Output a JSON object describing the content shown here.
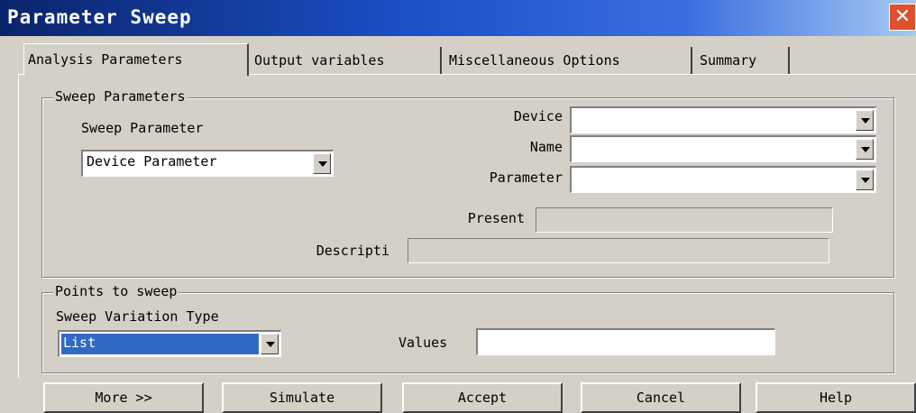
{
  "window": {
    "title": "Parameter Sweep",
    "close_glyph": "✕"
  },
  "tabs": [
    {
      "label": "Analysis Parameters"
    },
    {
      "label": "Output variables"
    },
    {
      "label": "Miscellaneous Options"
    },
    {
      "label": "Summary"
    }
  ],
  "sweep_parameters": {
    "group_title": "Sweep Parameters",
    "sweep_parameter_label": "Sweep Parameter",
    "sweep_parameter_value": "Device Parameter",
    "device_label": "Device",
    "device_value": "",
    "name_label": "Name",
    "name_value": "",
    "parameter_label": "Parameter",
    "parameter_value": "",
    "present_label": "Present",
    "present_value": "",
    "description_label": "Descripti",
    "description_value": ""
  },
  "points_to_sweep": {
    "group_title": "Points to sweep",
    "variation_type_label": "Sweep Variation Type",
    "variation_type_value": "List",
    "values_label": "Values",
    "values_value": ""
  },
  "buttons": {
    "more": "More >>",
    "simulate": "Simulate",
    "accept": "Accept",
    "cancel": "Cancel",
    "help": "Help"
  }
}
